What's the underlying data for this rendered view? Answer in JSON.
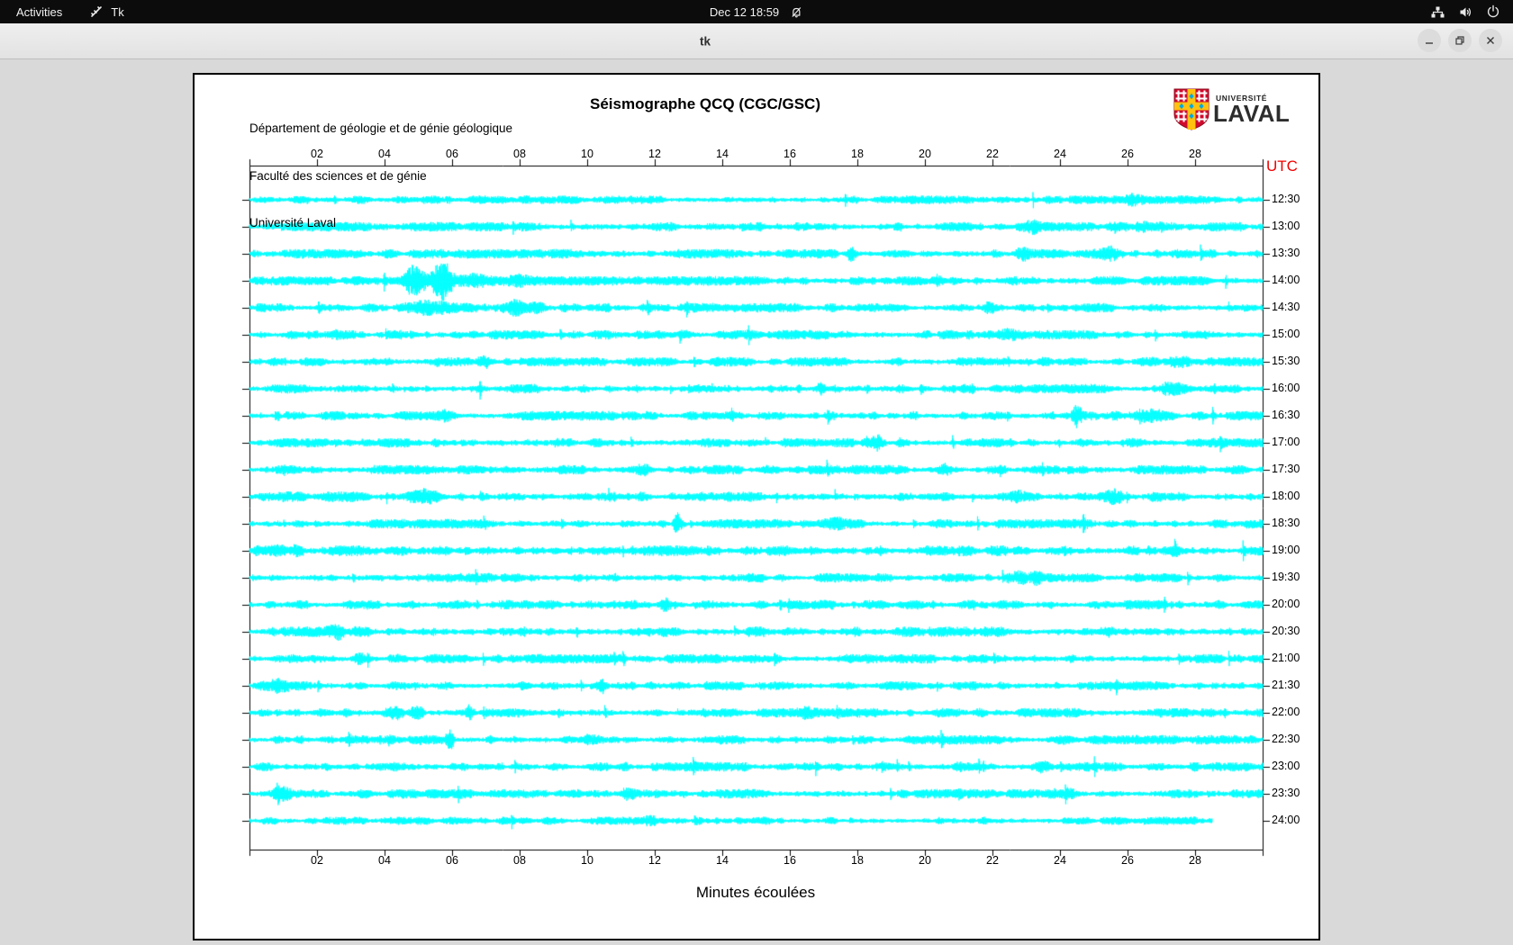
{
  "desktop": {
    "top_bar": {
      "activities": "Activities",
      "app_name": "Tk",
      "clock": "Dec 12 18:59",
      "icons": [
        "tk-app-icon",
        "notifications-off-icon",
        "network-icon",
        "volume-icon",
        "power-icon"
      ]
    }
  },
  "window": {
    "title": "tk",
    "controls": [
      "minimize",
      "maximize",
      "close"
    ]
  },
  "header": {
    "institution_lines": [
      "Département de géologie et de génie géologique",
      "Faculté des sciences et de génie",
      "Université Laval"
    ],
    "logo": {
      "line1": "UNIVERSITÉ",
      "line2": "LAVAL"
    }
  },
  "chart_data": {
    "type": "line",
    "title": "Séismographe QCQ (CGC/GSC)",
    "xlabel": "Minutes écoulées",
    "right_axis_label": "UTC",
    "right_axis_label_color": "#f20000",
    "trace_color": "#00ffff",
    "x_range_minutes": [
      0,
      30
    ],
    "x_ticks": [
      "02",
      "04",
      "06",
      "08",
      "10",
      "12",
      "14",
      "16",
      "18",
      "20",
      "22",
      "24",
      "26",
      "28"
    ],
    "rows": [
      {
        "utc": "12:30",
        "end": 30,
        "gain": 0.9,
        "events": [
          {
            "t": 26.2,
            "w": 0.2,
            "a": 5
          }
        ]
      },
      {
        "utc": "13:00",
        "end": 30,
        "gain": 1.0,
        "events": [
          {
            "t": 5.0,
            "w": 0.2,
            "a": 3
          },
          {
            "t": 23.2,
            "w": 0.2,
            "a": 4
          },
          {
            "t": 26.8,
            "w": 0.5,
            "a": 3
          }
        ]
      },
      {
        "utc": "13:30",
        "end": 30,
        "gain": 1.0,
        "events": [
          {
            "t": 17.8,
            "w": 0.12,
            "a": 7
          },
          {
            "t": 22.9,
            "w": 0.15,
            "a": 5
          },
          {
            "t": 25.5,
            "w": 0.3,
            "a": 4
          }
        ]
      },
      {
        "utc": "14:00",
        "end": 30,
        "gain": 1.0,
        "events": [
          {
            "t": 4.85,
            "w": 0.3,
            "a": 15
          },
          {
            "t": 5.7,
            "w": 0.33,
            "a": 17
          },
          {
            "t": 6.6,
            "w": 0.5,
            "a": 5
          },
          {
            "t": 8.0,
            "w": 0.3,
            "a": 3
          }
        ]
      },
      {
        "utc": "14:30",
        "end": 30,
        "gain": 1.0,
        "events": [
          {
            "t": 5.3,
            "w": 0.6,
            "a": 4
          },
          {
            "t": 7.9,
            "w": 0.25,
            "a": 5
          },
          {
            "t": 8.6,
            "w": 0.2,
            "a": 4
          },
          {
            "t": 21.9,
            "w": 0.15,
            "a": 4
          }
        ]
      },
      {
        "utc": "15:00",
        "end": 30,
        "gain": 1.0,
        "events": [
          {
            "t": 15.0,
            "w": 0.2,
            "a": 3
          },
          {
            "t": 22.5,
            "w": 0.2,
            "a": 3
          }
        ]
      },
      {
        "utc": "15:30",
        "end": 30,
        "gain": 1.0,
        "events": [
          {
            "t": 6.9,
            "w": 0.2,
            "a": 4
          },
          {
            "t": 27.5,
            "w": 0.4,
            "a": 4
          }
        ]
      },
      {
        "utc": "16:00",
        "end": 30,
        "gain": 1.0,
        "events": [
          {
            "t": 16.9,
            "w": 0.12,
            "a": 5
          },
          {
            "t": 27.3,
            "w": 0.3,
            "a": 4
          }
        ]
      },
      {
        "utc": "16:30",
        "end": 30,
        "gain": 1.0,
        "events": [
          {
            "t": 5.9,
            "w": 0.2,
            "a": 4
          },
          {
            "t": 24.5,
            "w": 0.12,
            "a": 9
          },
          {
            "t": 26.5,
            "w": 0.4,
            "a": 4
          }
        ]
      },
      {
        "utc": "17:00",
        "end": 30,
        "gain": 1.0,
        "events": [
          {
            "t": 18.6,
            "w": 0.15,
            "a": 6
          },
          {
            "t": 19.3,
            "w": 0.1,
            "a": 4
          }
        ]
      },
      {
        "utc": "17:30",
        "end": 30,
        "gain": 1.0,
        "events": [
          {
            "t": 11.7,
            "w": 0.15,
            "a": 4
          },
          {
            "t": 20.6,
            "w": 0.2,
            "a": 4
          }
        ]
      },
      {
        "utc": "18:00",
        "end": 30,
        "gain": 1.1,
        "events": [
          {
            "t": 5.2,
            "w": 0.4,
            "a": 3
          },
          {
            "t": 22.9,
            "w": 0.3,
            "a": 4
          },
          {
            "t": 25.6,
            "w": 0.2,
            "a": 4
          }
        ]
      },
      {
        "utc": "18:30",
        "end": 30,
        "gain": 1.0,
        "events": [
          {
            "t": 12.65,
            "w": 0.1,
            "a": 9
          },
          {
            "t": 17.4,
            "w": 0.3,
            "a": 3
          }
        ]
      },
      {
        "utc": "19:00",
        "end": 30,
        "gain": 1.15,
        "events": [
          {
            "t": 0.6,
            "w": 0.4,
            "a": 4
          },
          {
            "t": 1.4,
            "w": 0.2,
            "a": 4
          },
          {
            "t": 27.4,
            "w": 0.3,
            "a": 3
          }
        ]
      },
      {
        "utc": "19:30",
        "end": 30,
        "gain": 1.0,
        "events": [
          {
            "t": 22.7,
            "w": 0.25,
            "a": 5
          },
          {
            "t": 23.3,
            "w": 0.15,
            "a": 4
          }
        ]
      },
      {
        "utc": "20:00",
        "end": 30,
        "gain": 1.0,
        "events": [
          {
            "t": 12.3,
            "w": 0.15,
            "a": 4
          },
          {
            "t": 21.3,
            "w": 0.3,
            "a": 3
          }
        ]
      },
      {
        "utc": "20:30",
        "end": 30,
        "gain": 1.1,
        "events": [
          {
            "t": 2.6,
            "w": 0.25,
            "a": 5
          },
          {
            "t": 3.3,
            "w": 0.2,
            "a": 4
          },
          {
            "t": 25.4,
            "w": 0.2,
            "a": 4
          }
        ]
      },
      {
        "utc": "21:00",
        "end": 30,
        "gain": 1.0,
        "events": [
          {
            "t": 3.3,
            "w": 0.2,
            "a": 4
          },
          {
            "t": 21.7,
            "w": 0.2,
            "a": 3
          }
        ]
      },
      {
        "utc": "21:30",
        "end": 30,
        "gain": 1.0,
        "events": [
          {
            "t": 0.9,
            "w": 0.3,
            "a": 4
          },
          {
            "t": 10.45,
            "w": 0.1,
            "a": 6
          }
        ]
      },
      {
        "utc": "22:00",
        "end": 30,
        "gain": 1.0,
        "events": [
          {
            "t": 4.3,
            "w": 0.25,
            "a": 6
          },
          {
            "t": 4.9,
            "w": 0.2,
            "a": 5
          },
          {
            "t": 6.5,
            "w": 0.1,
            "a": 7
          },
          {
            "t": 16.5,
            "w": 0.2,
            "a": 3
          }
        ]
      },
      {
        "utc": "22:30",
        "end": 30,
        "gain": 1.0,
        "events": [
          {
            "t": 5.95,
            "w": 0.1,
            "a": 8
          },
          {
            "t": 10.2,
            "w": 0.25,
            "a": 4
          },
          {
            "t": 24.0,
            "w": 0.2,
            "a": 3
          }
        ]
      },
      {
        "utc": "23:00",
        "end": 30,
        "gain": 1.0,
        "events": [
          {
            "t": 21.0,
            "w": 0.15,
            "a": 4
          },
          {
            "t": 23.5,
            "w": 0.2,
            "a": 4
          }
        ]
      },
      {
        "utc": "23:30",
        "end": 30,
        "gain": 1.0,
        "events": [
          {
            "t": 0.9,
            "w": 0.3,
            "a": 5
          },
          {
            "t": 11.3,
            "w": 0.3,
            "a": 4
          },
          {
            "t": 24.2,
            "w": 0.3,
            "a": 4
          }
        ]
      },
      {
        "utc": "24:00",
        "end": 28.5,
        "gain": 0.85,
        "events": [
          {
            "t": 11.9,
            "w": 0.2,
            "a": 3
          }
        ]
      }
    ]
  }
}
